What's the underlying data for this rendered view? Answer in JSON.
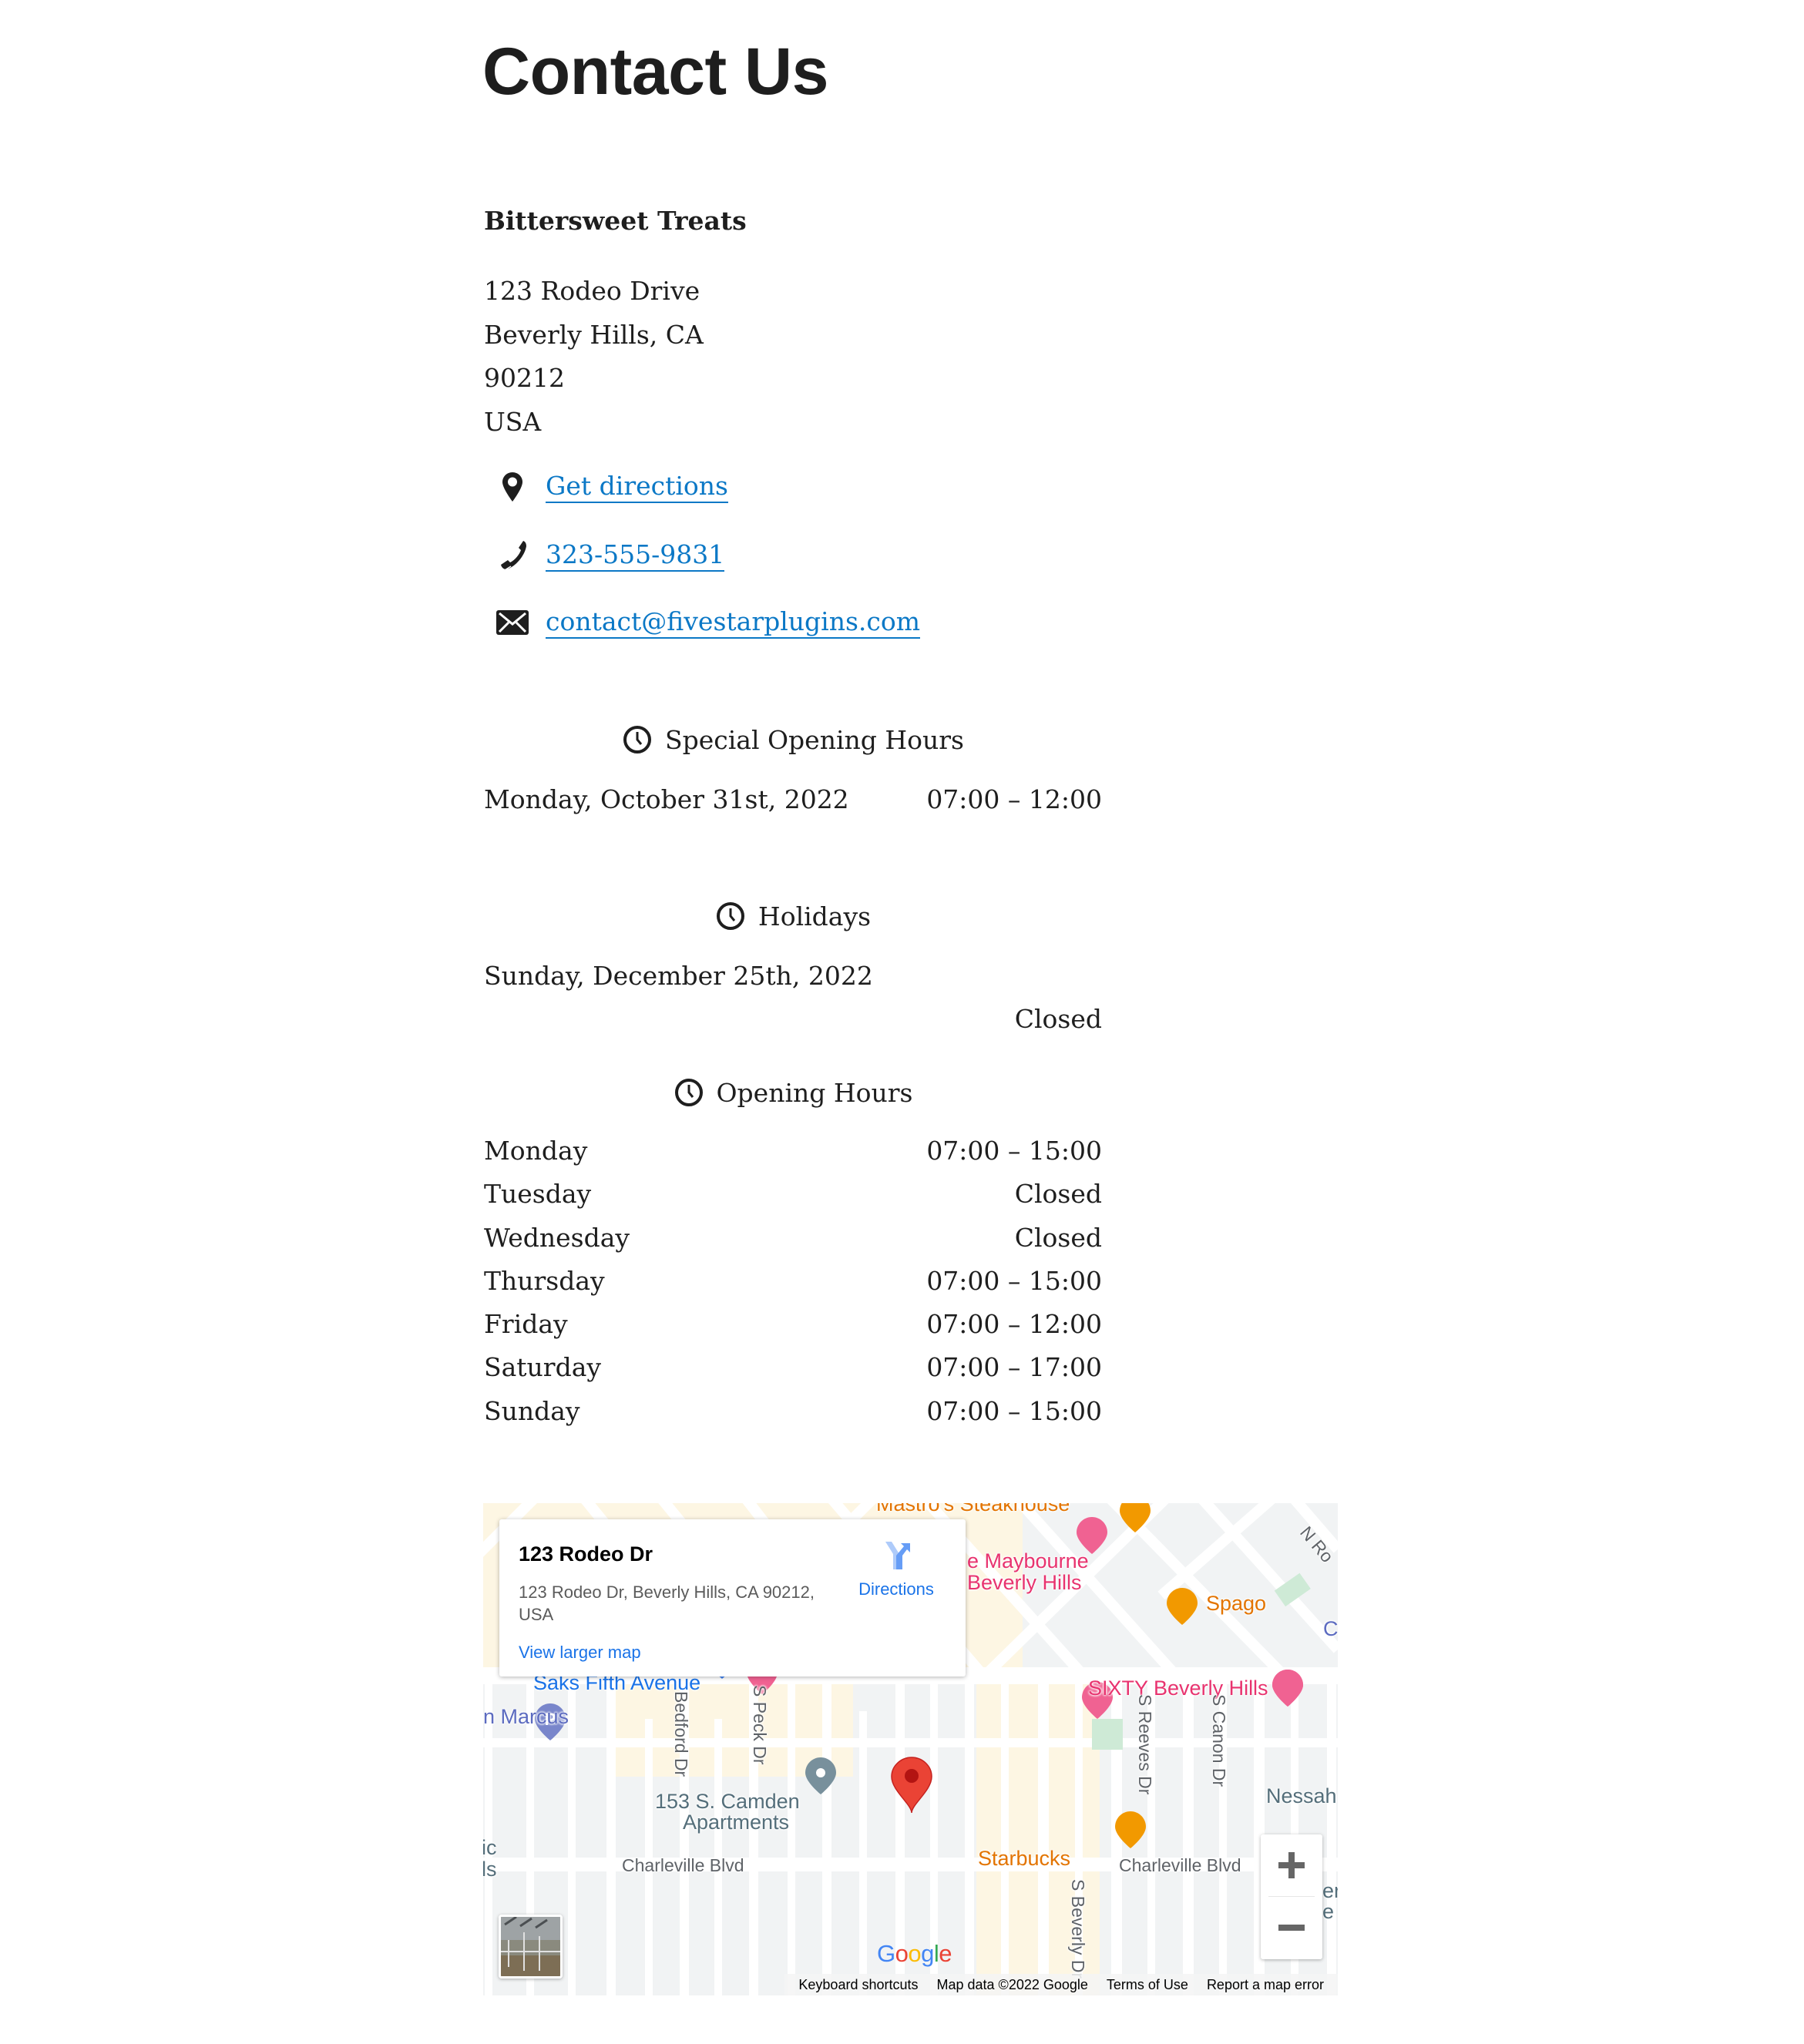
{
  "page": {
    "title": "Contact Us"
  },
  "business": {
    "name": "Bittersweet Treats",
    "address": [
      "123 Rodeo Drive",
      "Beverly Hills, CA",
      "90212",
      "USA"
    ],
    "contact": {
      "directions_label": "Get directions",
      "phone": "323-555-9831",
      "email": "contact@fivestarplugins.com"
    }
  },
  "special_hours": {
    "title": "Special Opening Hours",
    "rows": [
      {
        "date": "Monday, October 31st, 2022",
        "hours": "07:00 – 12:00"
      }
    ]
  },
  "holidays": {
    "title": "Holidays",
    "rows": [
      {
        "date": "Sunday, December 25th, 2022",
        "hours": "Closed"
      }
    ]
  },
  "opening_hours": {
    "title": "Opening Hours",
    "rows": [
      {
        "day": "Monday",
        "hours": "07:00 – 15:00"
      },
      {
        "day": "Tuesday",
        "hours": "Closed"
      },
      {
        "day": "Wednesday",
        "hours": "Closed"
      },
      {
        "day": "Thursday",
        "hours": "07:00 – 15:00"
      },
      {
        "day": "Friday",
        "hours": "07:00 – 12:00"
      },
      {
        "day": "Saturday",
        "hours": "07:00 – 17:00"
      },
      {
        "day": "Sunday",
        "hours": "07:00 – 15:00"
      }
    ]
  },
  "map": {
    "info_card": {
      "title": "123 Rodeo Dr",
      "address": "123 Rodeo Dr, Beverly Hills, CA 90212, USA",
      "directions_label": "Directions",
      "view_larger_label": "View larger map"
    },
    "labels": {
      "mastros": "Mastro's Steakhouse",
      "maybourne_1": "e Maybourne",
      "maybourne_2": "Beverly Hills",
      "spago": "Spago",
      "cl": "Cl",
      "n_rodeo": "N Ro",
      "saks": "Saks Fifth Avenue",
      "sixty": "SIXTY Beverly Hills",
      "neiman": "n Marcus",
      "bedford": "Bedford Dr",
      "peck": "S Peck Dr",
      "reeves": "S Reeves Dr",
      "canon": "S Canon Dr",
      "nessah": "Nessah",
      "camden_1": "153 S. Camden",
      "camden_2": "Apartments",
      "charleville_1": "Charleville Blvd",
      "charleville_2": "Charleville Blvd",
      "starbucks": "Starbucks",
      "beverly_dr": "S Beverly Dr",
      "left_edge_1": "ic",
      "left_edge_2": "ls",
      "right_edge_1": "erl",
      "right_edge_2": "e"
    },
    "google_logo": "Google",
    "attribution": {
      "keyboard": "Keyboard shortcuts",
      "map_data": "Map data ©2022 Google",
      "terms": "Terms of Use",
      "report": "Report a map error"
    },
    "colors": {
      "marker": "#ea4335",
      "hotel": "#e8336f",
      "food": "#e37400",
      "shop": "#1a73e8",
      "link": "#0b78c6"
    }
  }
}
